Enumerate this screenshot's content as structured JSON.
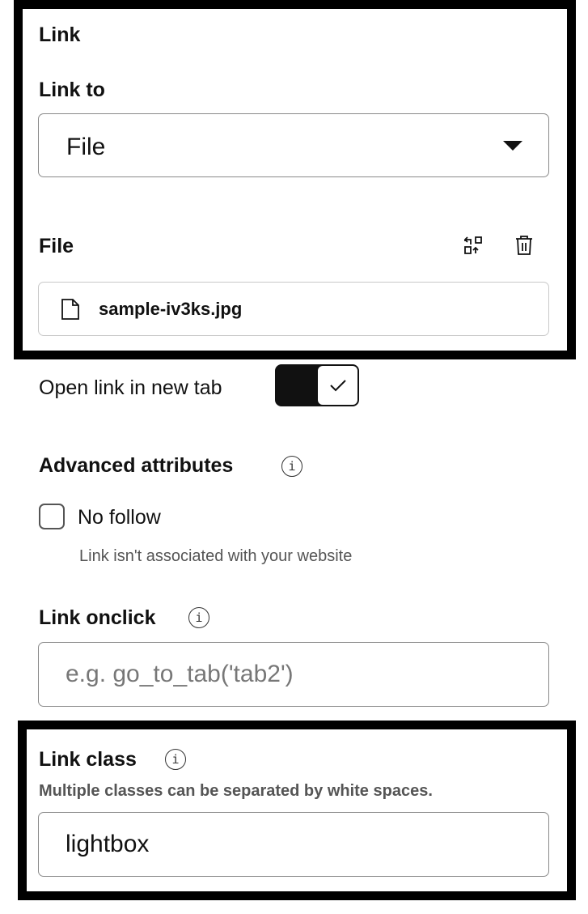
{
  "link_section": {
    "title": "Link",
    "link_to_label": "Link to",
    "link_to_value": "File",
    "file_label": "File",
    "file_name": "sample-iv3ks.jpg",
    "icons": {
      "replace": "replace-icon",
      "delete": "trash-icon",
      "file": "document-icon",
      "caret": "caret-down-icon"
    }
  },
  "new_tab": {
    "label": "Open link in new tab",
    "checked": true
  },
  "advanced": {
    "title": "Advanced attributes",
    "no_follow_label": "No follow",
    "no_follow_checked": false,
    "no_follow_help": "Link isn't associated with your website"
  },
  "onclick": {
    "label": "Link onclick",
    "value": "",
    "placeholder": "e.g. go_to_tab('tab2')"
  },
  "link_class": {
    "label": "Link class",
    "help": "Multiple classes can be separated by white spaces.",
    "value": "lightbox"
  },
  "colors": {
    "frame": "#000000",
    "toggle_on": "#111111",
    "border": "#8a8a8a",
    "help_text": "#555555"
  }
}
